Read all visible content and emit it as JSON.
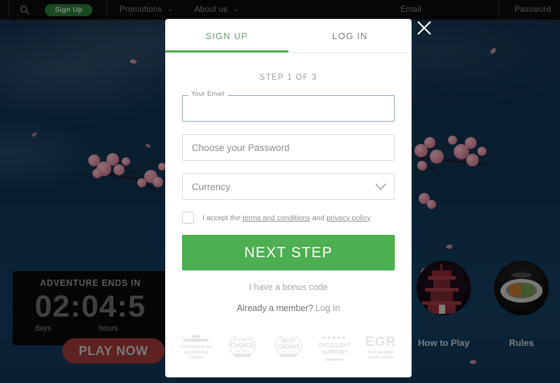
{
  "topbar": {
    "search_icon": "search-icon",
    "signup_label": "Sign Up",
    "promotions_label": "Promotions",
    "about_label": "About us",
    "email_label": "Email",
    "password_label": "Password",
    "caret_glyph": "⌄"
  },
  "scene": {
    "countdown": {
      "title": "ADVENTURE ENDS IN",
      "digits": "02:04:5",
      "unit_days": "days",
      "unit_hours": "hours"
    },
    "play_now_label": "PLAY NOW",
    "how_to_play_label": "How to Play",
    "rules_label": "Rules"
  },
  "modal": {
    "close_icon": "close-icon",
    "tabs": [
      {
        "label": "SIGN UP",
        "active": true
      },
      {
        "label": "LOG IN",
        "active": false
      }
    ],
    "step_label": "STEP 1 OF 3",
    "email": {
      "floating_label": "Your Email",
      "value": "",
      "placeholder": ""
    },
    "password": {
      "placeholder": "Choose your Password",
      "value": ""
    },
    "currency": {
      "selected": "Currency",
      "chevron_icon": "chevron-down-icon"
    },
    "terms": {
      "checked": false,
      "prefix": "I accept the ",
      "link1": "terms and conditions",
      "middle": " and ",
      "link2": "privacy policy"
    },
    "next_step_label": "NEXT STEP",
    "bonus_code_label": "I have a bonus code",
    "member_prefix": "Already a member? ",
    "member_link": "Log In",
    "badges": [
      {
        "line1": "CASINOMEISTER",
        "line2": "ACCREDITED",
        "line3": "CASINO"
      },
      {
        "line1": "PLAYER'S",
        "line2": "CHOICE",
        "line3": "OF 2018"
      },
      {
        "line1": "BEST",
        "line2": "CASINO",
        "line3": "OF 2017"
      },
      {
        "line1": "★★★★★",
        "line2": "EXCELLENT",
        "line3": "SUPPORT"
      },
      {
        "line1": "EGR",
        "line2": "2018 AWARDS",
        "line3": "SHORTLISTED"
      }
    ]
  },
  "colors": {
    "accent_green": "#4caf50",
    "sky": "#13304b",
    "topbar": "#0b0b0b",
    "play_now_red": "#a33b3b",
    "focus_border": "#8fa6b5"
  }
}
